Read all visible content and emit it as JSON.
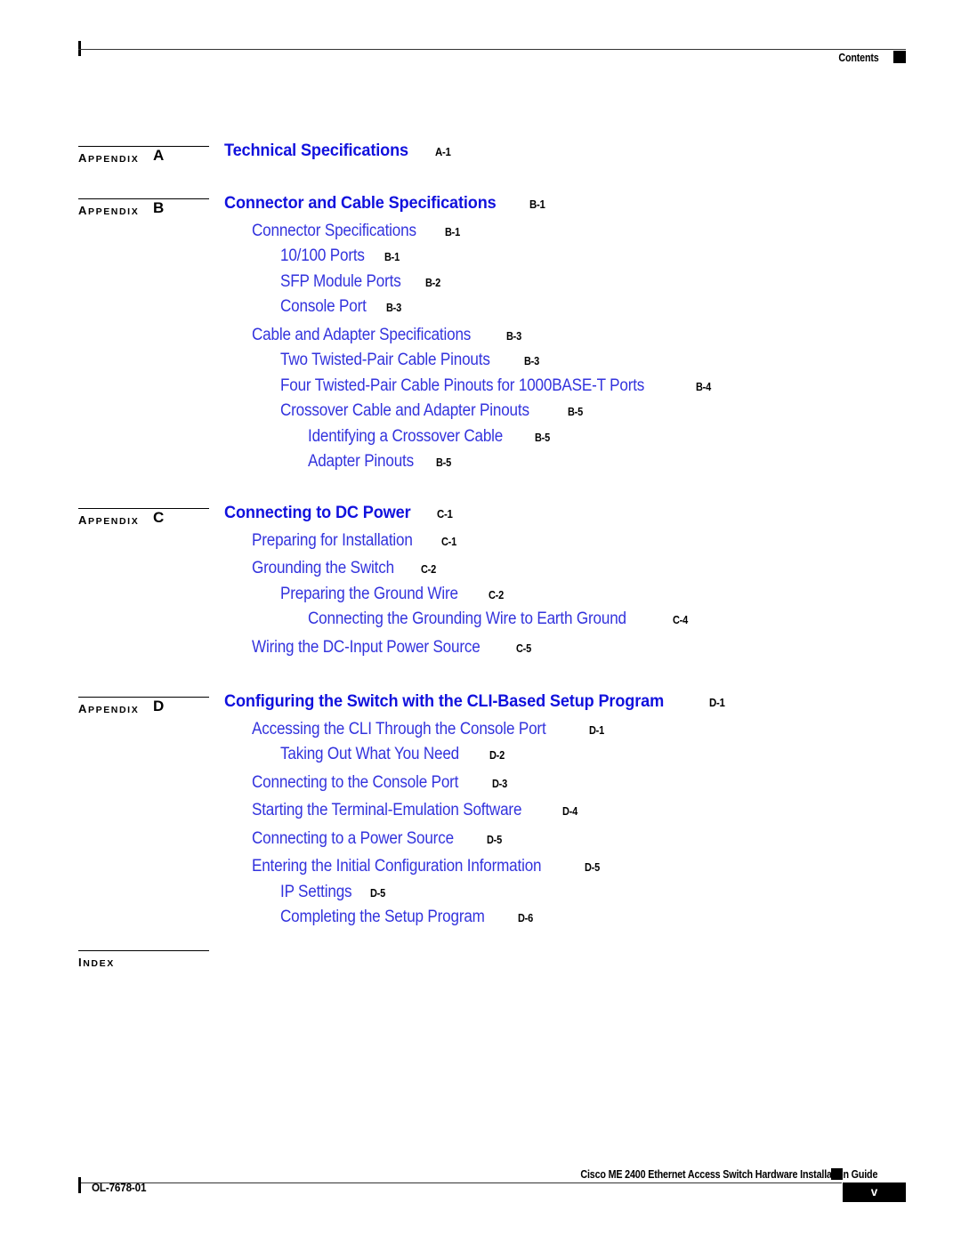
{
  "header": {
    "title": "Contents",
    "marker_icon": "black-square-marker"
  },
  "toc": {
    "groups": [
      {
        "marker_word": "APPENDIX",
        "marker_letter": "A",
        "entries": [
          {
            "level": 0,
            "title": "Technical Specifications",
            "page": "A-1"
          }
        ]
      },
      {
        "marker_word": "APPENDIX",
        "marker_letter": "B",
        "entries": [
          {
            "level": 0,
            "title": "Connector and Cable Specifications",
            "page": "B-1"
          },
          {
            "level": 1,
            "title": "Connector Specifications",
            "page": "B-1"
          },
          {
            "level": 2,
            "title": "10/100 Ports",
            "page": "B-1"
          },
          {
            "level": 2,
            "title": "SFP Module Ports",
            "page": "B-2"
          },
          {
            "level": 2,
            "title": "Console Port",
            "page": "B-3"
          },
          {
            "level": 1,
            "title": "Cable and Adapter Specifications",
            "page": "B-3"
          },
          {
            "level": 2,
            "title": "Two Twisted-Pair Cable Pinouts",
            "page": "B-3"
          },
          {
            "level": 2,
            "title": "Four Twisted-Pair Cable Pinouts for 1000BASE-T Ports",
            "page": "B-4"
          },
          {
            "level": 2,
            "title": "Crossover Cable and Adapter Pinouts",
            "page": "B-5"
          },
          {
            "level": 3,
            "title": "Identifying a Crossover Cable",
            "page": "B-5"
          },
          {
            "level": 3,
            "title": "Adapter Pinouts",
            "page": "B-5"
          }
        ]
      },
      {
        "marker_word": "APPENDIX",
        "marker_letter": "C",
        "entries": [
          {
            "level": 0,
            "title": "Connecting to DC Power",
            "page": "C-1"
          },
          {
            "level": 1,
            "title": "Preparing for Installation",
            "page": "C-1"
          },
          {
            "level": 1,
            "title": "Grounding the Switch",
            "page": "C-2"
          },
          {
            "level": 2,
            "title": "Preparing the Ground Wire",
            "page": "C-2"
          },
          {
            "level": 3,
            "title": "Connecting the Grounding Wire to Earth Ground",
            "page": "C-4"
          },
          {
            "level": 1,
            "title": "Wiring the DC-Input Power Source",
            "page": "C-5"
          }
        ]
      },
      {
        "marker_word": "APPENDIX",
        "marker_letter": "D",
        "entries": [
          {
            "level": 0,
            "title": "Configuring the Switch with the CLI-Based Setup Program",
            "page": "D-1"
          },
          {
            "level": 1,
            "title": "Accessing the CLI Through the Console Port",
            "page": "D-1"
          },
          {
            "level": 2,
            "title": "Taking Out What You Need",
            "page": "D-2"
          },
          {
            "level": 1,
            "title": "Connecting to the Console Port",
            "page": "D-3"
          },
          {
            "level": 1,
            "title": "Starting the Terminal-Emulation Software",
            "page": "D-4"
          },
          {
            "level": 1,
            "title": "Connecting to a Power Source",
            "page": "D-5"
          },
          {
            "level": 1,
            "title": "Entering the Initial Configuration Information",
            "page": "D-5"
          },
          {
            "level": 2,
            "title": "IP Settings",
            "page": "D-5"
          },
          {
            "level": 2,
            "title": "Completing the Setup Program",
            "page": "D-6"
          }
        ]
      },
      {
        "marker_word": "INDEX",
        "marker_letter": "",
        "entries": []
      }
    ]
  },
  "footer": {
    "guide_title": "Cisco ME 2400 Ethernet Access Switch Hardware Installation Guide",
    "doc_id": "OL-7678-01",
    "page_number": "v",
    "marker_icon": "black-square-marker"
  },
  "colors": {
    "heading_blue": "#1111DD",
    "entry_blue": "#3333DD",
    "marker_black": "#000000"
  }
}
